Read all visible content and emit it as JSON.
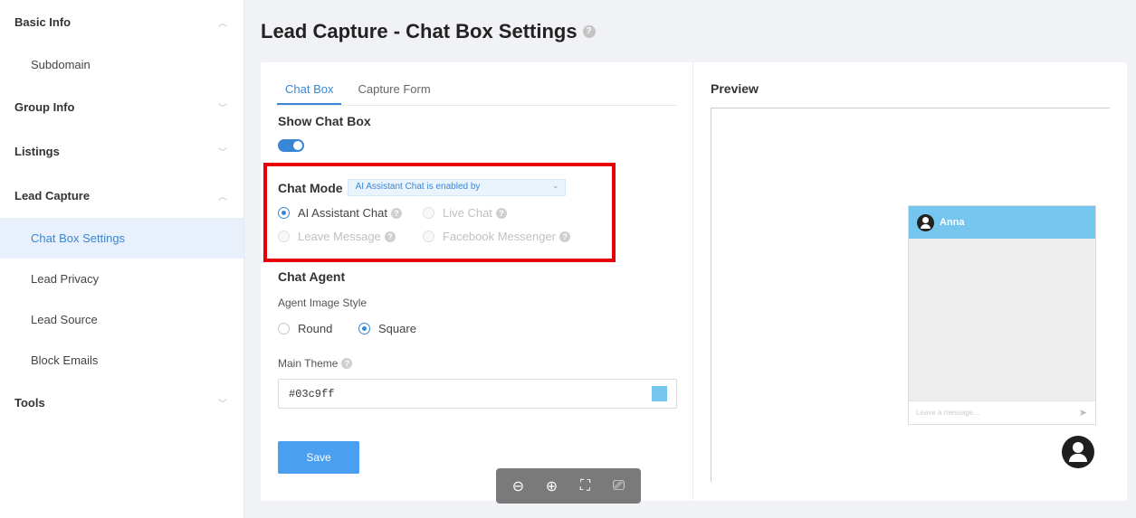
{
  "sidebar": {
    "groups": [
      {
        "label": "Basic Info",
        "expanded": true,
        "items": [
          "Subdomain"
        ]
      },
      {
        "label": "Group Info",
        "expanded": false,
        "items": []
      },
      {
        "label": "Listings",
        "expanded": false,
        "items": []
      },
      {
        "label": "Lead Capture",
        "expanded": true,
        "items": [
          "Chat Box Settings",
          "Lead Privacy",
          "Lead Source",
          "Block Emails"
        ]
      },
      {
        "label": "Tools",
        "expanded": false,
        "items": []
      }
    ],
    "active_item": "Chat Box Settings"
  },
  "page": {
    "title": "Lead Capture - Chat Box Settings",
    "help": "?"
  },
  "tabs": [
    {
      "label": "Chat Box",
      "active": true
    },
    {
      "label": "Capture Form",
      "active": false
    }
  ],
  "show_chat_box": {
    "title": "Show Chat Box",
    "enabled": true
  },
  "chat_mode": {
    "title": "Chat Mode",
    "select_value": "AI Assistant Chat is enabled by",
    "options": [
      {
        "label": "AI Assistant Chat",
        "checked": true,
        "disabled": false
      },
      {
        "label": "Live Chat",
        "checked": false,
        "disabled": true
      },
      {
        "label": "Leave Message",
        "checked": false,
        "disabled": true
      },
      {
        "label": "Facebook Messenger",
        "checked": false,
        "disabled": true
      }
    ]
  },
  "chat_agent": {
    "title": "Chat Agent",
    "image_style_label": "Agent Image Style",
    "image_styles": [
      {
        "label": "Round",
        "checked": false
      },
      {
        "label": "Square",
        "checked": true
      }
    ],
    "theme_label": "Main Theme",
    "theme_value": "#03c9ff",
    "theme_swatch": "#74c6ee"
  },
  "save_label": "Save",
  "preview": {
    "title": "Preview",
    "agent_name": "Anna",
    "input_placeholder": "Leave a message..."
  },
  "colors": {
    "accent": "#3a86d6",
    "highlight": "#e8000b",
    "chat_header": "#74c6ee"
  }
}
